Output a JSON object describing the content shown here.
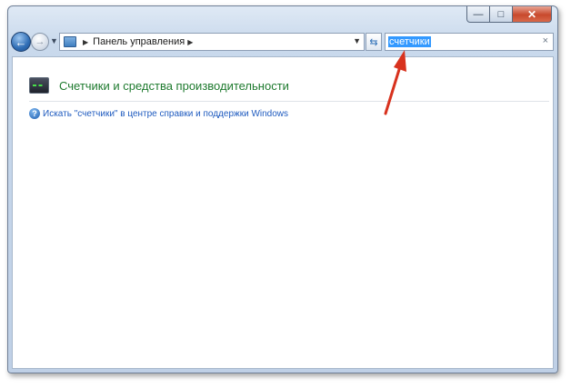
{
  "window": {
    "minimize_glyph": "—",
    "maximize_glyph": "□",
    "close_glyph": "✕"
  },
  "nav": {
    "back_glyph": "←",
    "forward_glyph": "→",
    "history_dropdown_glyph": "▼"
  },
  "address_bar": {
    "crumb_separator_glyph": "▶",
    "breadcrumb": "Панель управления",
    "crumb_after_glyph": "▶",
    "dropdown_glyph": "▼"
  },
  "refresh": {
    "glyph": "⇆"
  },
  "search": {
    "value": "счетчики",
    "clear_glyph": "×"
  },
  "results": {
    "item_title": "Счетчики и средства производительности",
    "help_link": "Искать \"счетчики\" в центре справки и поддержки Windows",
    "help_icon_glyph": "?"
  },
  "colors": {
    "result_title": "#1e7a2e",
    "link": "#1f5bbf",
    "annotation_arrow": "#d8321e",
    "search_selection": "#3399ff"
  },
  "icons": {
    "back": "back-arrow-icon",
    "forward": "forward-arrow-icon",
    "control_panel": "control-panel-icon",
    "refresh": "refresh-icon",
    "clear": "close-icon",
    "result": "performance-monitor-icon",
    "help": "help-icon"
  }
}
